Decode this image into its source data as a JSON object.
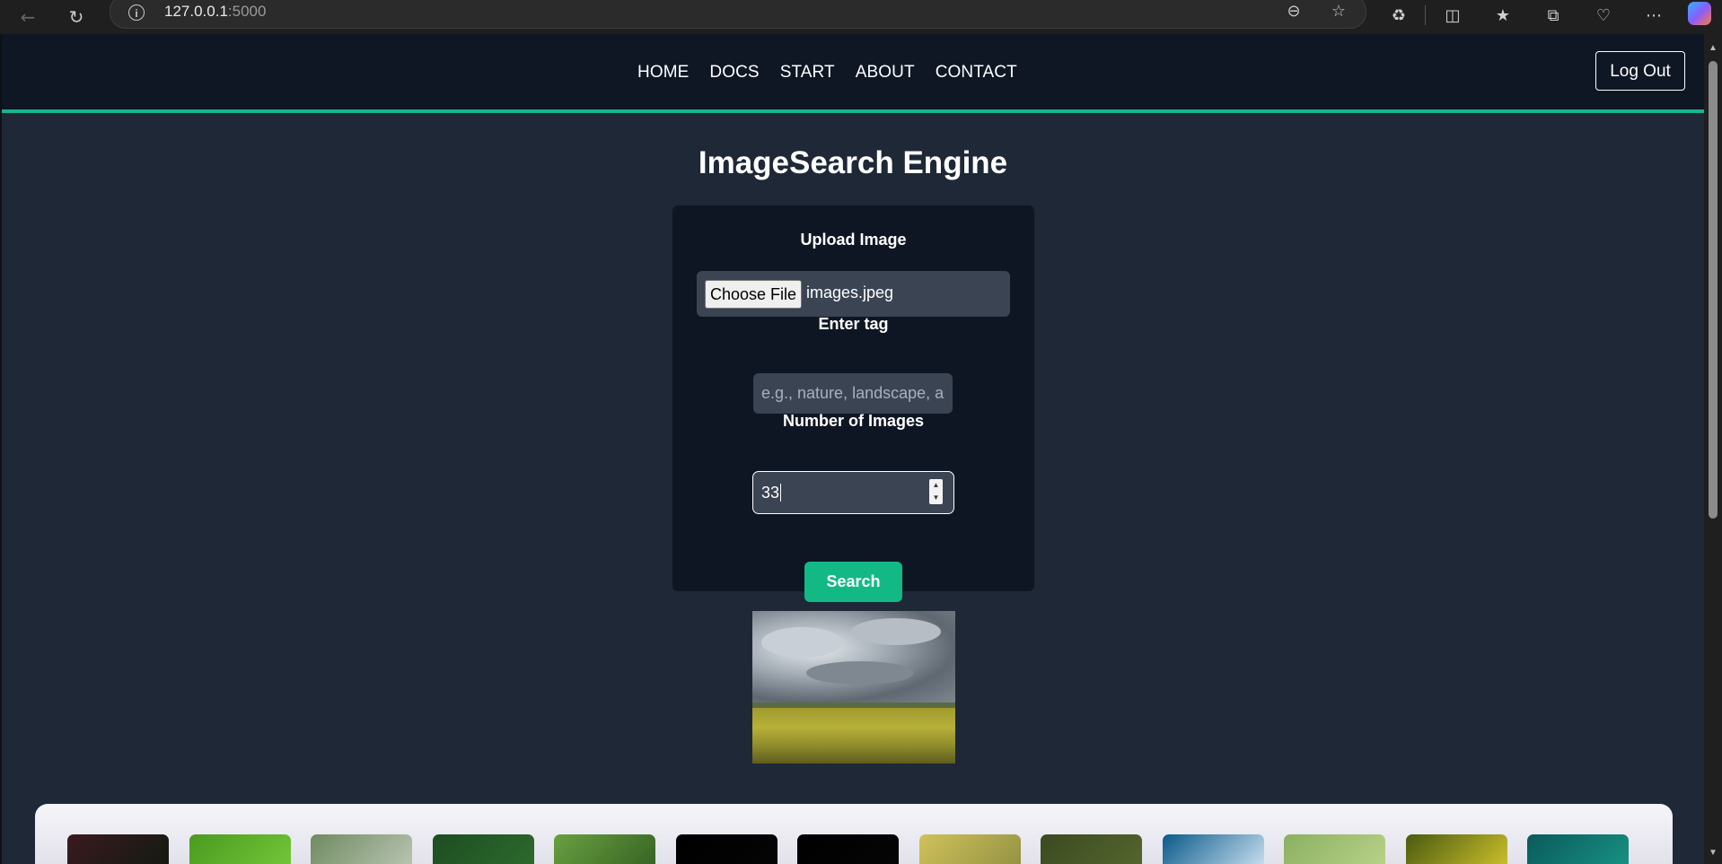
{
  "browser": {
    "url_host": "127.0.0.1",
    "url_port": ":5000",
    "icons": [
      "back-icon",
      "reload-icon",
      "info-icon",
      "zoom-out-icon",
      "favorite-star-icon",
      "extensions-icon",
      "split-screen-icon",
      "favorites-icon",
      "collections-icon",
      "browser-essentials-icon",
      "more-icon",
      "copilot-icon"
    ]
  },
  "nav": {
    "items": [
      "HOME",
      "DOCS",
      "START",
      "ABOUT",
      "CONTACT"
    ],
    "logout": "Log Out"
  },
  "main": {
    "title": "ImageSearch Engine",
    "upload_label": "Upload Image",
    "choose_file": "Choose File",
    "file_name": "images.jpeg",
    "tag_label": "Enter tag",
    "tag_placeholder": "e.g., nature, landscape, an",
    "count_label": "Number of Images",
    "count_value": "33",
    "search_button": "Search"
  },
  "colors": {
    "accent": "#19b58a",
    "header_bg": "#0f1724",
    "page_bg": "#1e2836",
    "card_bg": "#0f1623",
    "input_bg": "#3a4453"
  },
  "gallery": {
    "thumbnails": [
      {
        "colors": [
          "#3a1a1f",
          "#0e1a0f"
        ]
      },
      {
        "colors": [
          "#4a9a20",
          "#7acd3c"
        ]
      },
      {
        "colors": [
          "#6f8a60",
          "#c5cfc0"
        ]
      },
      {
        "colors": [
          "#1d4d20",
          "#2f6f30"
        ]
      },
      {
        "colors": [
          "#6aa040",
          "#2e5a20"
        ]
      },
      {
        "colors": [
          "#000000",
          "#050505"
        ]
      },
      {
        "colors": [
          "#000000",
          "#060606"
        ]
      },
      {
        "colors": [
          "#cfc25a",
          "#8a8a40"
        ]
      },
      {
        "colors": [
          "#3a4a20",
          "#5a6a30"
        ]
      },
      {
        "colors": [
          "#0a5a8a",
          "#e8f4ff"
        ]
      },
      {
        "colors": [
          "#8ab060",
          "#c0d890"
        ]
      },
      {
        "colors": [
          "#4a5a10",
          "#e0d030"
        ]
      },
      {
        "colors": [
          "#0a5a5a",
          "#1a9a8a"
        ]
      }
    ]
  }
}
